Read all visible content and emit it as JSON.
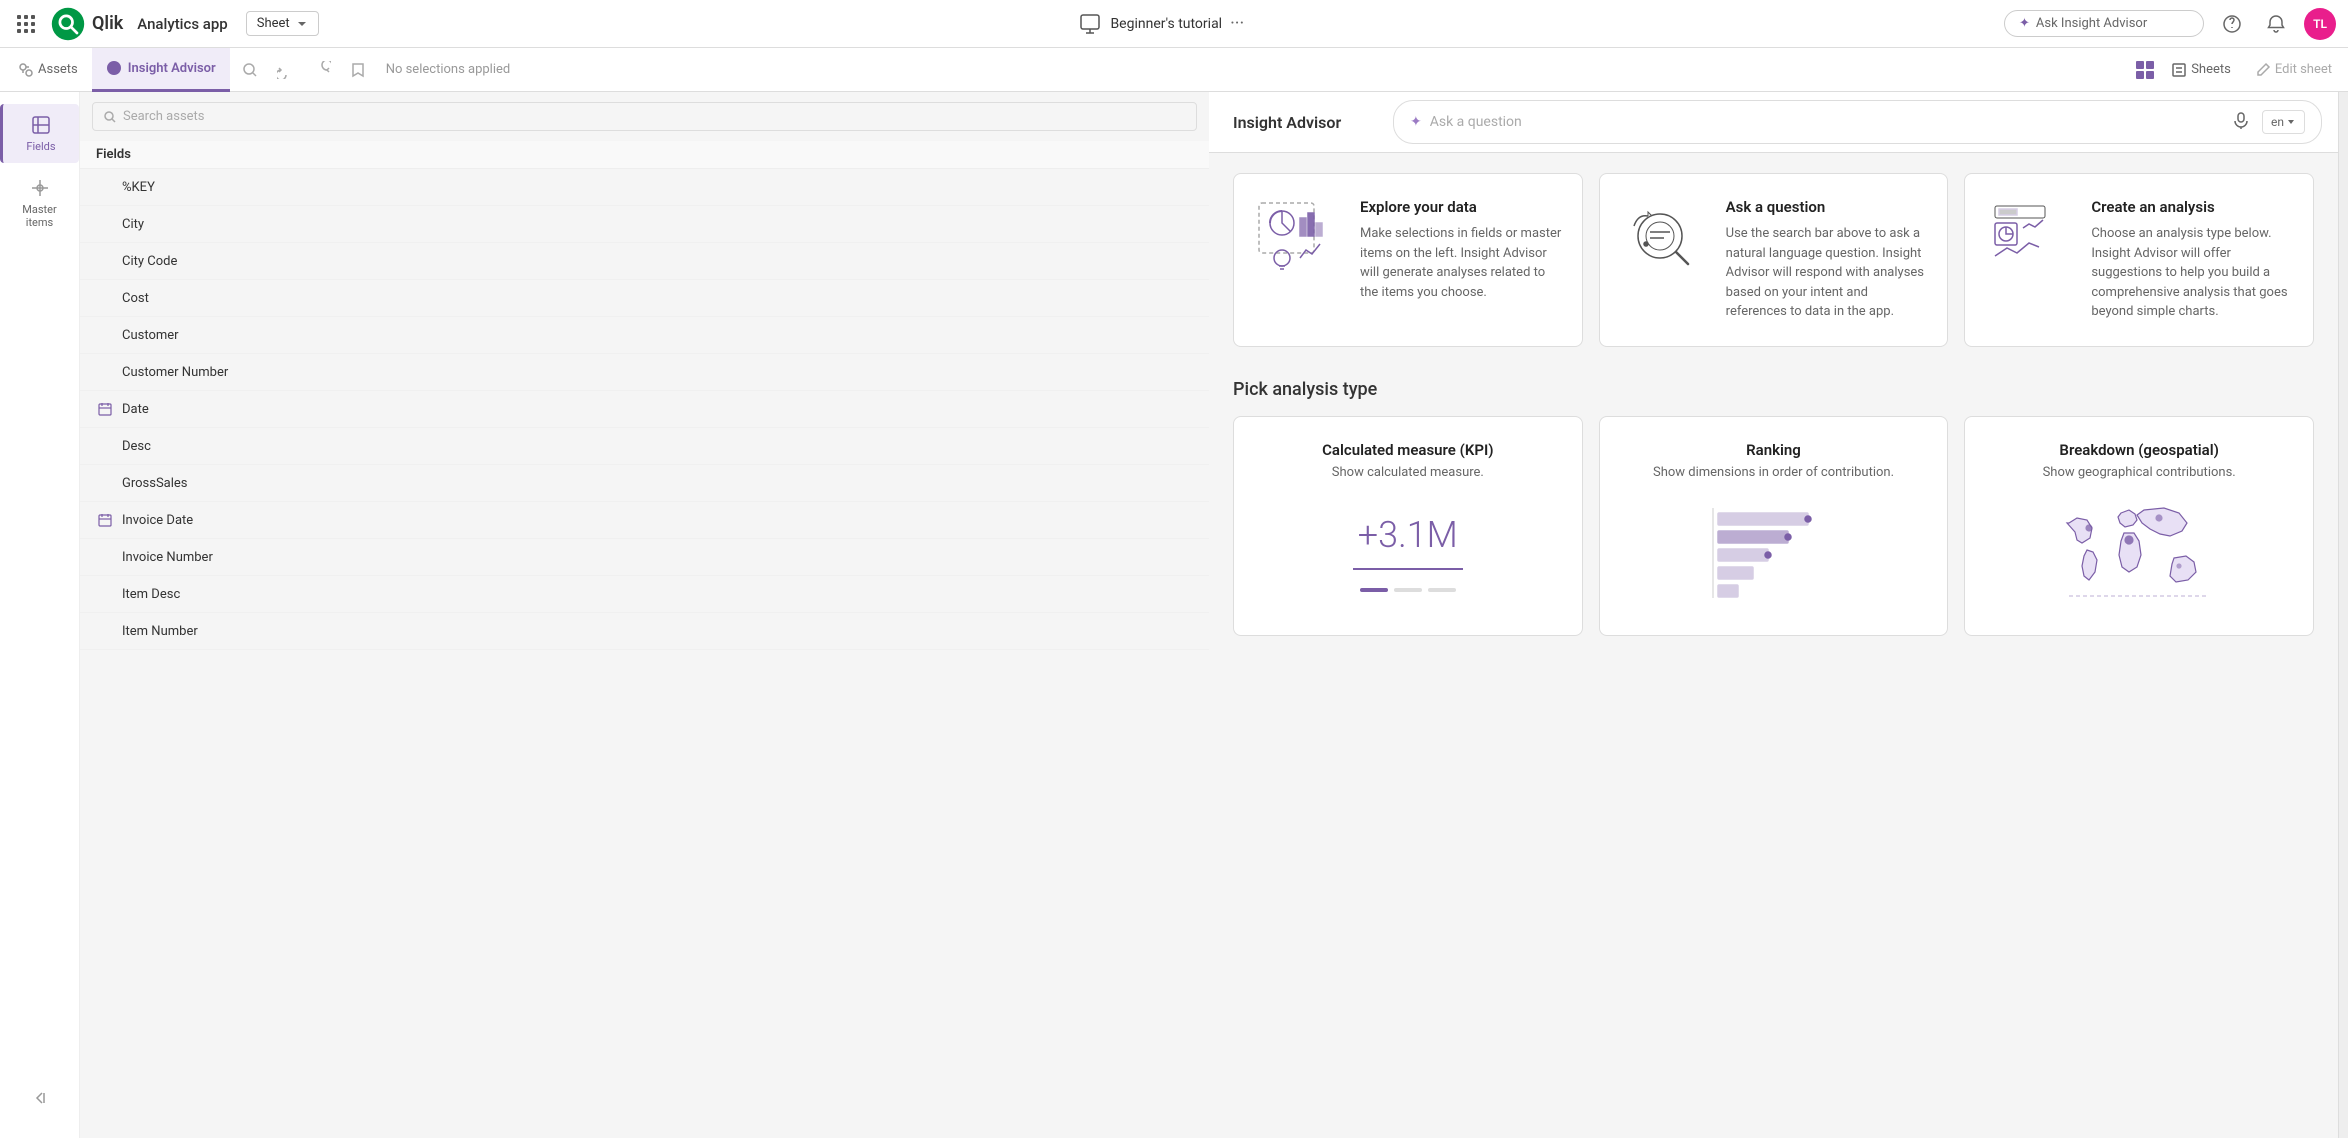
{
  "topNav": {
    "appTitle": "Analytics app",
    "sheetLabel": "Sheet",
    "tutorialLabel": "Beginner's tutorial",
    "askInsightPlaceholder": "Ask Insight Advisor",
    "avatarInitials": "TL"
  },
  "toolbar": {
    "assetsLabel": "Assets",
    "insightAdvisorLabel": "Insight Advisor",
    "noSelectionsLabel": "No selections applied",
    "sheetsLabel": "Sheets",
    "editSheetLabel": "Edit sheet"
  },
  "insightAdvisorPanel": {
    "title": "Insight Advisor",
    "askPlaceholder": "Ask a question",
    "languageLabel": "en"
  },
  "sidebar": {
    "fieldsLabel": "Fields",
    "masterItemsLabel": "Master items"
  },
  "fieldsList": {
    "searchPlaceholder": "Search assets",
    "sectionLabel": "Fields",
    "items": [
      {
        "name": "%KEY",
        "hasIcon": false
      },
      {
        "name": "City",
        "hasIcon": false
      },
      {
        "name": "City Code",
        "hasIcon": false
      },
      {
        "name": "Cost",
        "hasIcon": false
      },
      {
        "name": "Customer",
        "hasIcon": false
      },
      {
        "name": "Customer Number",
        "hasIcon": false
      },
      {
        "name": "Date",
        "hasIcon": true,
        "iconType": "calendar"
      },
      {
        "name": "Desc",
        "hasIcon": false
      },
      {
        "name": "GrossSales",
        "hasIcon": false
      },
      {
        "name": "Invoice Date",
        "hasIcon": true,
        "iconType": "calendar"
      },
      {
        "name": "Invoice Number",
        "hasIcon": false
      },
      {
        "name": "Item Desc",
        "hasIcon": false
      },
      {
        "name": "Item Number",
        "hasIcon": false
      }
    ]
  },
  "infoCards": [
    {
      "title": "Explore your data",
      "description": "Make selections in fields or master items on the left. Insight Advisor will generate analyses related to the items you choose."
    },
    {
      "title": "Ask a question",
      "description": "Use the search bar above to ask a natural language question. Insight Advisor will respond with analyses based on your intent and references to data in the app."
    },
    {
      "title": "Create an analysis",
      "description": "Choose an analysis type below. Insight Advisor will offer suggestions to help you build a comprehensive analysis that goes beyond simple charts."
    }
  ],
  "analysisSection": {
    "title": "Pick analysis type",
    "cards": [
      {
        "title": "Calculated measure (KPI)",
        "description": "Show calculated measure.",
        "kpiValue": "+3.1M"
      },
      {
        "title": "Ranking",
        "description": "Show dimensions in order of contribution."
      },
      {
        "title": "Breakdown (geospatial)",
        "description": "Show geographical contributions."
      }
    ]
  }
}
